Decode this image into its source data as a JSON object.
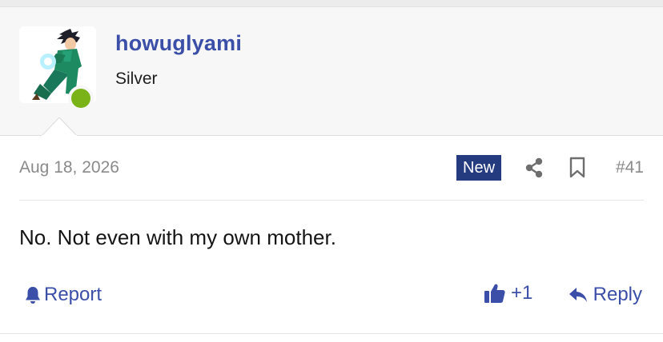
{
  "post": {
    "user": {
      "username": "howuglyami",
      "title": "Silver",
      "avatar_icon": "anime-character-avatar",
      "status_icon": "online-indicator-icon",
      "status_color": "#7ab317"
    },
    "date": "Aug 18, 2026",
    "badge": "New",
    "share_icon": "share-icon",
    "bookmark_icon": "bookmark-icon",
    "number": "#41",
    "message": "No. Not even with my own mother.",
    "actions": {
      "report_label": "Report",
      "like_count": "+1",
      "reply_label": "Reply"
    }
  },
  "colors": {
    "link": "#3b4fa8",
    "badge_bg": "#253b80",
    "header_bg": "#f7f7f7",
    "muted_text": "#8a8a8a"
  }
}
